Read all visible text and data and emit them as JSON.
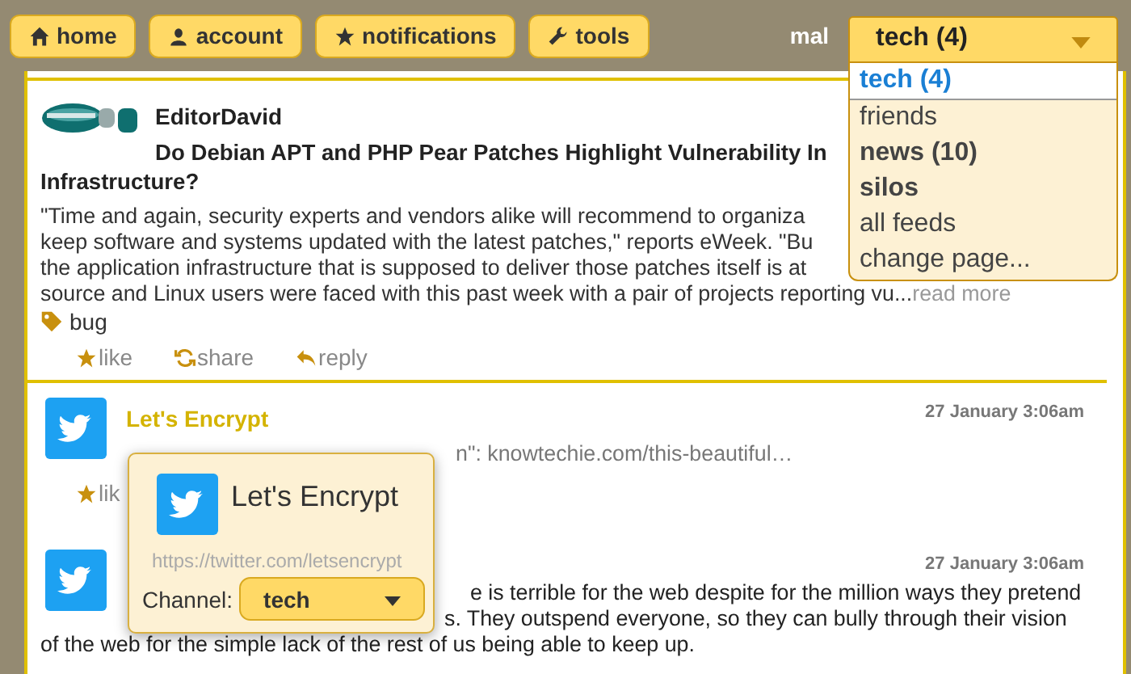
{
  "nav": {
    "buttons": [
      {
        "label": "home"
      },
      {
        "label": "account"
      },
      {
        "label": "notifications"
      },
      {
        "label": "tools"
      }
    ],
    "user": "mal",
    "feed_select": {
      "value": "tech (4)",
      "options": [
        {
          "label": "tech (4)",
          "selected": true,
          "unread": true
        },
        {
          "label": "friends",
          "selected": false,
          "unread": false
        },
        {
          "label": "news (10)",
          "selected": false,
          "unread": true
        },
        {
          "label": "silos",
          "selected": false,
          "unread": true
        },
        {
          "label": "all feeds",
          "selected": false,
          "unread": false
        },
        {
          "label": "change page...",
          "selected": false,
          "unread": false
        }
      ]
    }
  },
  "posts": [
    {
      "kind": "article",
      "author": "EditorDavid",
      "title_lines": [
        "Do Debian APT and PHP Pear Patches Highlight Vulnerability In",
        "Infrastructure?"
      ],
      "body_lines": [
        "\"Time and again, security experts and vendors alike will recommend to organiza",
        "keep software and systems updated with the latest patches,\" reports eWeek. \"Bu",
        "the application infrastructure that is supposed to deliver those patches itself is at",
        "source and Linux users were faced with this past week with a pair of projects reporting vu..."
      ],
      "read_more": "read more",
      "tag": "bug",
      "actions": [
        {
          "label": "like"
        },
        {
          "label": "share"
        },
        {
          "label": "reply"
        }
      ]
    },
    {
      "kind": "tweet",
      "author": "Let's Encrypt",
      "date": "27 January 3:06am",
      "body_lines": [
        "n\": knowtechie.com/this-beautiful…"
      ],
      "actions": [
        {
          "label": "lik"
        }
      ]
    },
    {
      "kind": "tweet",
      "date": "27 January 3:06am",
      "body_lines": [
        "e is terrible for the web despite for the million ways they pretend",
        "s. They outspend everyone, so they can bully through their vision",
        "of the web for the simple lack of the rest of us being able to keep up."
      ]
    }
  ],
  "popover": {
    "name": "Let's Encrypt",
    "url": "https://twitter.com/letsencrypt",
    "channel_label": "Channel:",
    "channel_value": "tech"
  }
}
